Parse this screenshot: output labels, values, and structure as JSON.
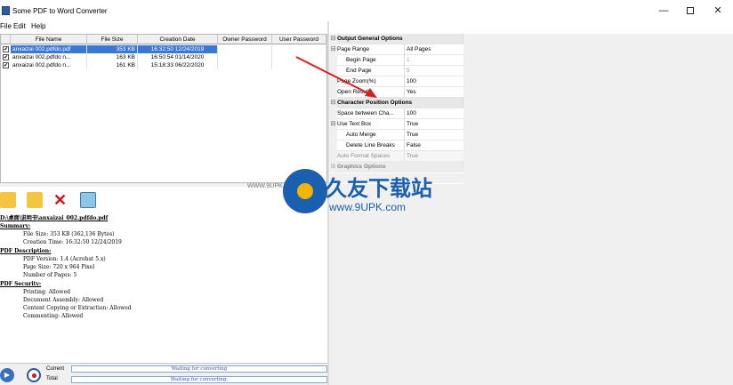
{
  "window": {
    "title": "Some PDF to Word Converter",
    "minimize": "—",
    "close": "✕"
  },
  "menu": [
    "File",
    "Edit",
    "Help"
  ],
  "grid": {
    "headers": [
      "File Name",
      "File Size",
      "Creation Date",
      "Owner Password",
      "User Password"
    ],
    "rows": [
      {
        "name": "anxaizai 002.pdfdo.pdf",
        "size": "353 KB",
        "date": "16:32:50 12/24/2019",
        "owner": "",
        "user": "",
        "selected": true
      },
      {
        "name": "anxaizai 002.pdfdo n...",
        "size": "163 KB",
        "date": "16:50:54 01/14/2020",
        "owner": "",
        "user": "",
        "selected": false
      },
      {
        "name": "anxaizai 002.pdfdo n...",
        "size": "161 KB",
        "date": "15:18:33 06/22/2020",
        "owner": "",
        "user": "",
        "selected": false
      }
    ]
  },
  "toolbar": {
    "icons": [
      "folder-open-icon",
      "folder-icon",
      "delete-icon",
      "recycle-bin-icon"
    ],
    "delete_glyph": "✕"
  },
  "details": {
    "path": "D:\\桌面\\说明书\\anxaizai_002.pdfdo.pdf",
    "summary_head": "Summary:",
    "file_size": "File Size: 353 KB (362,136 Bytes)",
    "creation_time": "Creation Time: 16:32:50 12/24/2019",
    "pdf_desc_head": "PDF Description:",
    "pdf_version": "PDF Version: 1.4 (Acrobat 5.x)",
    "page_size": "Page Size: 720 x 964 Pixel",
    "num_pages": "Number of Pages: 5",
    "pdf_sec_head": "PDF Security:",
    "printing": "Printing: Allowed",
    "doc_assembly": "Document Assembly: Allowed",
    "content_copy": "Content Copying or Extraction: Allowed",
    "commenting": "Commenting: Allowed"
  },
  "progress": {
    "current_label": "Current",
    "total_label": "Total",
    "current_status": "Waiting for converting",
    "total_status": "Waiting for converting."
  },
  "properties": {
    "cat1": "Output General Options",
    "page_range": {
      "name": "Page Range",
      "value": "All Pages"
    },
    "begin_page": {
      "name": "Begin Page",
      "value": "1"
    },
    "end_page": {
      "name": "End Page",
      "value": "5"
    },
    "page_zoom": {
      "name": "Page Zoom(%)",
      "value": "100"
    },
    "open_results": {
      "name": "Open Results",
      "value": "Yes"
    },
    "cat2": "Character Position Options",
    "space_between": {
      "name": "Space between Cha...",
      "value": "100"
    },
    "use_text_box": {
      "name": "Use Text Box",
      "value": "True"
    },
    "auto_merge": {
      "name": "Auto Merge",
      "value": "True"
    },
    "delete_line_breaks": {
      "name": "Delete Line Breaks",
      "value": "False"
    },
    "auto_format_spaces": {
      "name": "Auto Format Spaces",
      "value": "True"
    },
    "cat3": "Graphics Options",
    "expander_minus": "⊟",
    "expander_plus": "⊞"
  },
  "watermark": {
    "cn": "久友下载站",
    "url": "www.9UPK.com",
    "small": "WWW.9UPK.COM"
  },
  "colors": {
    "selection": "#3a78d6",
    "arrow": "#d42020",
    "brand": "#1b5fb0"
  }
}
